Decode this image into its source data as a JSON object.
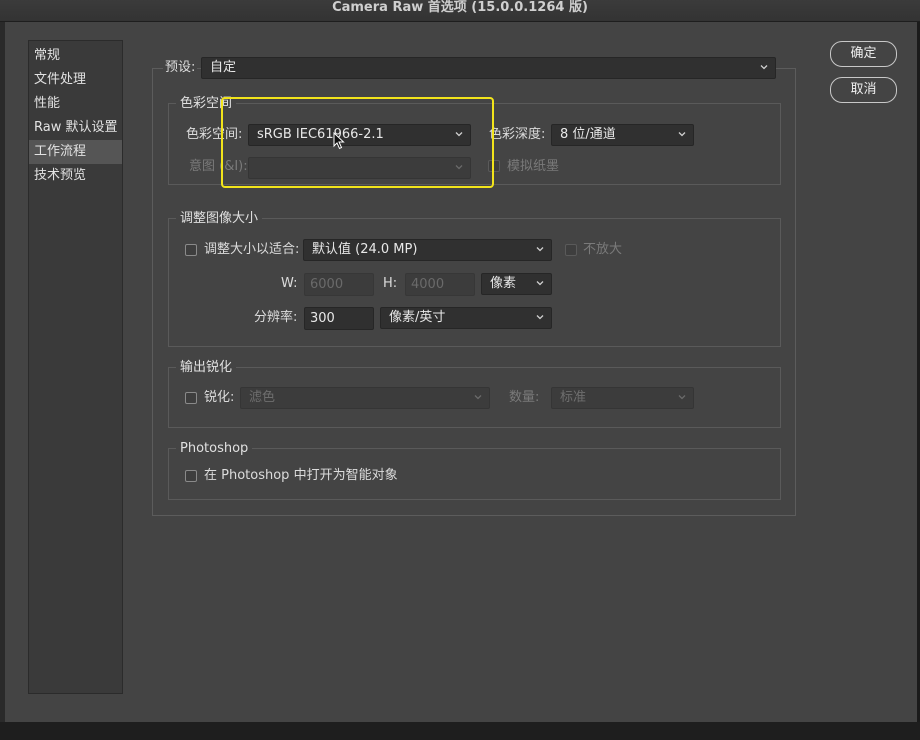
{
  "window": {
    "title": "Camera Raw 首选项 (15.0.0.1264 版)"
  },
  "sidebar": {
    "items": [
      {
        "label": "常规"
      },
      {
        "label": "文件处理"
      },
      {
        "label": "性能"
      },
      {
        "label": "Raw 默认设置"
      },
      {
        "label": "工作流程",
        "selected": true
      },
      {
        "label": "技术预览"
      }
    ]
  },
  "buttons": {
    "ok": "确定",
    "cancel": "取消"
  },
  "preset": {
    "label": "预设:",
    "value": "自定"
  },
  "color_space": {
    "title": "色彩空间",
    "space_label": "色彩空间:",
    "space_value": "sRGB IEC61966-2.1",
    "depth_label": "色彩深度:",
    "depth_value": "8 位/通道",
    "intent_label": "意图 (&I):",
    "intent_value": "",
    "simulate_paper_label": "模拟纸墨"
  },
  "resize": {
    "title": "调整图像大小",
    "fit_label": "调整大小以适合:",
    "fit_value": "默认值 (24.0 MP)",
    "no_enlarge_label": "不放大",
    "w_label": "W:",
    "w_value": "6000",
    "h_label": "H:",
    "h_value": "4000",
    "unit_value": "像素",
    "resolution_label": "分辨率:",
    "resolution_value": "300",
    "resolution_unit_value": "像素/英寸"
  },
  "sharpen": {
    "title": "输出锐化",
    "sharpen_label": "锐化:",
    "sharpen_value": "滤色",
    "amount_label": "数量:",
    "amount_value": "标准"
  },
  "photoshop": {
    "title": "Photoshop",
    "smart_object_label": "在 Photoshop 中打开为智能对象"
  },
  "colors": {
    "highlight": "#f2e41b",
    "panel": "#444444"
  }
}
